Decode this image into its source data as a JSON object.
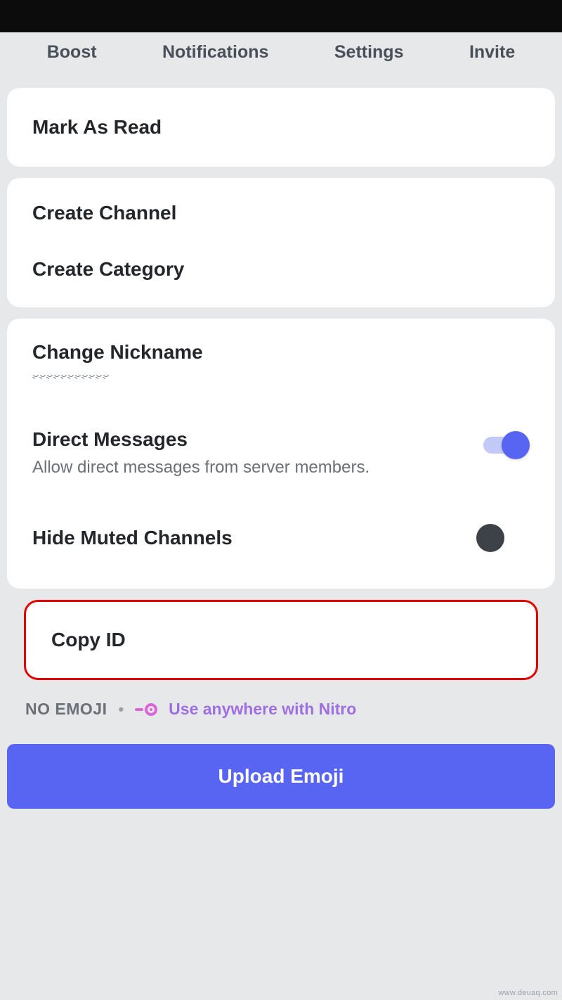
{
  "tabs": {
    "boost": "Boost",
    "notifications": "Notifications",
    "settings": "Settings",
    "invite": "Invite"
  },
  "actions": {
    "mark_as_read": "Mark As Read",
    "create_channel": "Create Channel",
    "create_category": "Create Category",
    "change_nickname": "Change Nickname",
    "copy_id": "Copy ID"
  },
  "settings": {
    "direct_messages": {
      "title": "Direct Messages",
      "desc": "Allow direct messages from server members.",
      "enabled": true
    },
    "hide_muted": {
      "title": "Hide Muted Channels",
      "enabled": false
    }
  },
  "emoji": {
    "no_emoji_label": "NO EMOJI",
    "nitro_promo": "Use anywhere with Nitro",
    "upload_button": "Upload Emoji"
  },
  "watermark": "www.deuaq.com"
}
